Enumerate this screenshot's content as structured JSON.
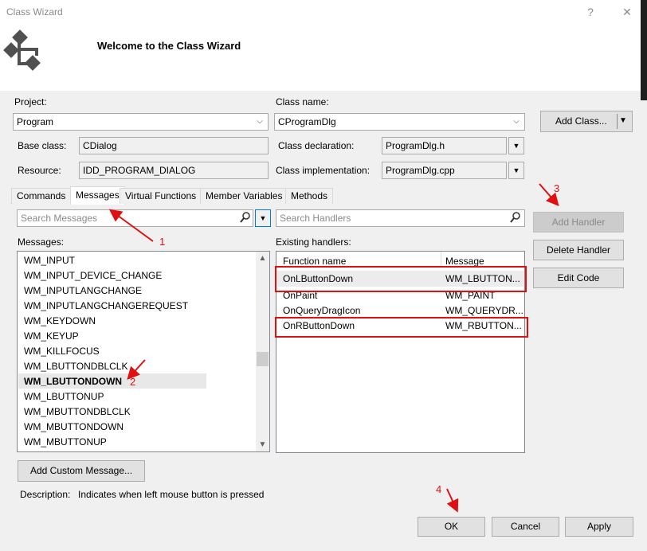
{
  "window": {
    "title": "Class Wizard",
    "help_glyph": "?",
    "close_glyph": "✕",
    "header_title": "Welcome to the Class Wizard"
  },
  "project": {
    "project_label": "Project:",
    "project_value": "Program",
    "classname_label": "Class name:",
    "classname_value": "CProgramDlg",
    "add_class_label": "Add Class...",
    "base_class_label": "Base class:",
    "base_class_value": "CDialog",
    "class_decl_label": "Class declaration:",
    "class_decl_value": "ProgramDlg.h",
    "resource_label": "Resource:",
    "resource_value": "IDD_PROGRAM_DIALOG",
    "class_impl_label": "Class implementation:",
    "class_impl_value": "ProgramDlg.cpp"
  },
  "tabs": [
    {
      "label": "Commands"
    },
    {
      "label": "Messages"
    },
    {
      "label": "Virtual Functions"
    },
    {
      "label": "Member Variables"
    },
    {
      "label": "Methods"
    }
  ],
  "messages": {
    "search_placeholder": "Search Messages",
    "list_label": "Messages:",
    "items": [
      "WM_INPUT",
      "WM_INPUT_DEVICE_CHANGE",
      "WM_INPUTLANGCHANGE",
      "WM_INPUTLANGCHANGEREQUEST",
      "WM_KEYDOWN",
      "WM_KEYUP",
      "WM_KILLFOCUS",
      "WM_LBUTTONDBLCLK",
      "WM_LBUTTONDOWN",
      "WM_LBUTTONUP",
      "WM_MBUTTONDBLCLK",
      "WM_MBUTTONDOWN",
      "WM_MBUTTONUP"
    ],
    "selected": "WM_LBUTTONDOWN",
    "scroll_position": 0.55
  },
  "handlers": {
    "search_placeholder": "Search Handlers",
    "list_label": "Existing handlers:",
    "col_function": "Function name",
    "col_message": "Message",
    "rows": [
      {
        "fn": "OnLButtonDown",
        "msg": "WM_LBUTTON..."
      },
      {
        "fn": "OnPaint",
        "msg": "WM_PAINT"
      },
      {
        "fn": "OnQueryDragIcon",
        "msg": "WM_QUERYDR..."
      },
      {
        "fn": "OnRButtonDown",
        "msg": "WM_RBUTTON..."
      }
    ]
  },
  "side_buttons": {
    "add_handler": "Add Handler",
    "delete_handler": "Delete Handler",
    "edit_code": "Edit Code"
  },
  "bottom": {
    "add_custom_message": "Add Custom Message...",
    "description_label": "Description:",
    "description_text": "Indicates when left mouse button is pressed",
    "ok": "OK",
    "cancel": "Cancel",
    "apply": "Apply"
  },
  "annotations": {
    "n1": "1",
    "n2": "2",
    "n3": "3",
    "n4": "4",
    "color": "#e01010"
  },
  "icons": {
    "dropdown": "chevron-down-icon",
    "search": "search-icon",
    "wizard": "class-wizard-icon"
  }
}
